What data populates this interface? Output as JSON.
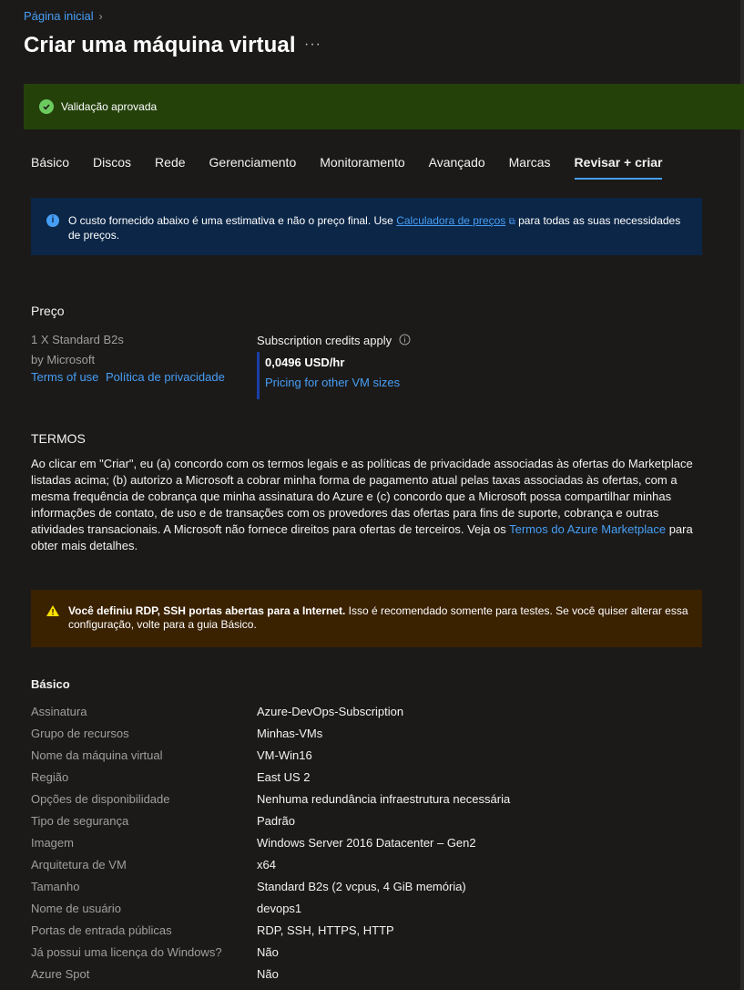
{
  "breadcrumb": {
    "home": "Página inicial",
    "chevron": "›"
  },
  "page_title": "Criar uma máquina virtual",
  "more_label": "···",
  "validation": {
    "text": "Validação aprovada",
    "color": "#24410a",
    "icon": "check-circle-icon"
  },
  "tabs": [
    {
      "label": "Básico"
    },
    {
      "label": "Discos"
    },
    {
      "label": "Rede"
    },
    {
      "label": "Gerenciamento"
    },
    {
      "label": "Monitoramento"
    },
    {
      "label": "Avançado"
    },
    {
      "label": "Marcas"
    },
    {
      "label": "Revisar + criar",
      "active": true
    }
  ],
  "info": {
    "text_before": "O custo fornecido abaixo é uma estimativa e não o preço final. Use ",
    "link": "Calculadora de preços",
    "text_after": " para todas as suas necessidades de preços."
  },
  "price": {
    "heading": "Preço",
    "product": "1 X Standard B2s",
    "publisher": "by Microsoft",
    "terms_link": "Terms of use",
    "privacy_link": "Política de privacidade",
    "credits": "Subscription credits apply",
    "amount": "0,0496 USD/hr",
    "other_sizes_link": "Pricing for other VM sizes"
  },
  "terms": {
    "heading": "TERMOS",
    "text": "Ao clicar em \"Criar\", eu (a) concordo com os termos legais e as políticas de privacidade associadas às ofertas do Marketplace listadas acima; (b) autorizo a Microsoft a cobrar minha forma de pagamento atual pelas taxas associadas às ofertas, com a mesma frequência de cobrança que minha assinatura do Azure e (c) concordo que a Microsoft possa compartilhar minhas informações de contato, de uso e de transações com os provedores das ofertas para fins de suporte, cobrança e outras atividades transacionais. A Microsoft não fornece direitos para ofertas de terceiros. Veja os ",
    "link": "Termos do Azure Marketplace",
    "text_after": " para obter mais detalhes."
  },
  "warning": {
    "bold": "Você definiu RDP, SSH portas abertas para a Internet.",
    "text": "  Isso é recomendado somente para testes.  Se você quiser alterar essa configuração, volte para a guia Básico."
  },
  "basics": {
    "heading": "Básico",
    "rows": [
      {
        "label": "Assinatura",
        "value": "Azure-DevOps-Subscription"
      },
      {
        "label": "Grupo de recursos",
        "value": "Minhas-VMs"
      },
      {
        "label": "Nome da máquina virtual",
        "value": "VM-Win16"
      },
      {
        "label": "Região",
        "value": "East US 2"
      },
      {
        "label": "Opções de disponibilidade",
        "value": "Nenhuma redundância infraestrutura necessária"
      },
      {
        "label": "Tipo de segurança",
        "value": "Padrão"
      },
      {
        "label": "Imagem",
        "value": "Windows Server 2016 Datacenter – Gen2"
      },
      {
        "label": "Arquitetura de VM",
        "value": "x64"
      },
      {
        "label": "Tamanho",
        "value": "Standard B2s (2 vcpus, 4 GiB memória)"
      },
      {
        "label": "Nome de usuário",
        "value": "devops1"
      },
      {
        "label": "Portas de entrada públicas",
        "value": "RDP, SSH, HTTPS, HTTP"
      },
      {
        "label": "Já possui uma licença do Windows?",
        "value": "Não"
      },
      {
        "label": "Azure Spot",
        "value": "Não"
      }
    ]
  },
  "colors": {
    "accent": "#479ef5",
    "background": "#1b1a19",
    "success": "#6ccb5f",
    "warning_bg": "#3a2100",
    "info_bg": "#0b2647"
  }
}
